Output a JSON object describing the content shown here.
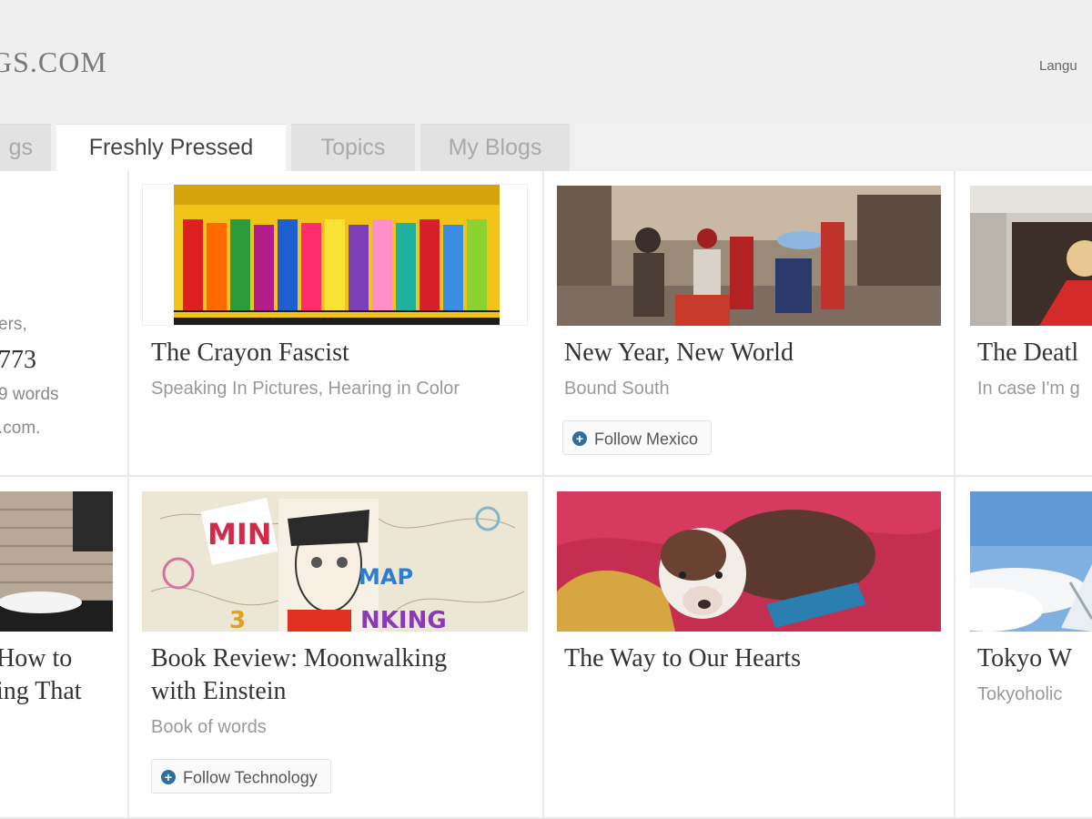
{
  "header": {
    "logo": "GS.COM",
    "language": "Langu"
  },
  "tabs": [
    {
      "label": "gs",
      "active": false
    },
    {
      "label": "Freshly Pressed",
      "active": true
    },
    {
      "label": "Topics",
      "active": false
    },
    {
      "label": "My Blogs",
      "active": false
    }
  ],
  "stats": {
    "line1": "ers,",
    "line2": "773",
    "line3": "9 words",
    "line4": ".com."
  },
  "posts": [
    {
      "title": "The Crayon Fascist",
      "blog": "Speaking In Pictures, Hearing in Color"
    },
    {
      "title": "New Year, New World",
      "blog": "Bound South",
      "follow": "Follow Mexico"
    },
    {
      "title": "The Deatl",
      "blog": "In case I'm g"
    },
    {
      "title_line1": "How to",
      "title_line2": "ing That"
    },
    {
      "title_line1": "Book Review: Moonwalking",
      "title_line2": "with Einstein",
      "blog": "Book of words",
      "follow": "Follow Technology"
    },
    {
      "title": "The Way to Our Hearts"
    },
    {
      "title": "Tokyo W",
      "blog": "Tokyoholic"
    }
  ],
  "colors": {
    "follow_icon": "#2f6f9e",
    "page_bg": "#f0f0f0",
    "active_tab": "#ffffff",
    "inactive_tab": "#e2e2e2"
  }
}
